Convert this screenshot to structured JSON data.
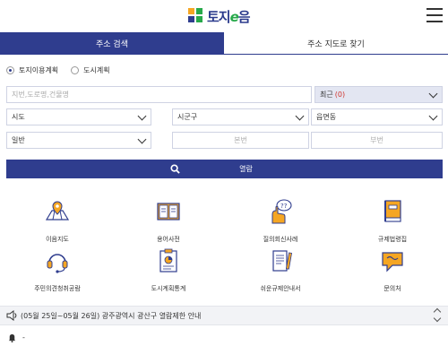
{
  "header": {
    "logo_text_pre": "토지",
    "logo_text_e": "e",
    "logo_text_post": "음",
    "menu_icon": "hamburger-icon"
  },
  "tabs": [
    {
      "label": "주소 검색",
      "active": true
    },
    {
      "label": "주소 지도로 찾기",
      "active": false
    }
  ],
  "search": {
    "radio_options": [
      {
        "label": "토지이용계획",
        "selected": true
      },
      {
        "label": "도시계획",
        "selected": false
      }
    ],
    "address_placeholder": "지번,도로명,건물명",
    "recent_label": "최근",
    "recent_count": "(0)",
    "sido": "시도",
    "sigungu": "시군구",
    "eupmyeondong": "읍면동",
    "land_type": "일반",
    "bon_placeholder": "본번",
    "bu_placeholder": "부번",
    "submit_label": "열람"
  },
  "menu": [
    {
      "label": "이음지도",
      "icon": "map-pin-icon"
    },
    {
      "label": "용어사전",
      "icon": "book-icon"
    },
    {
      "label": "질의회신사례",
      "icon": "qa-icon"
    },
    {
      "label": "규제법령집",
      "icon": "law-book-icon"
    },
    {
      "label": "주민의견청취공람",
      "icon": "headset-icon"
    },
    {
      "label": "도시계획통계",
      "icon": "clipboard-chart-icon"
    },
    {
      "label": "쉬운규제안내서",
      "icon": "guide-icon"
    },
    {
      "label": "문의처",
      "icon": "chat-bubble-icon"
    }
  ],
  "notice": {
    "text": "(05월 25일~05월 26일) 광주광역시 광산구 열람제한 안내",
    "icon": "speaker-icon"
  },
  "bell_text": "-",
  "colors": {
    "primary": "#2f3d8e",
    "accent_orange": "#f5a623",
    "recent_count": "#d0342c"
  }
}
